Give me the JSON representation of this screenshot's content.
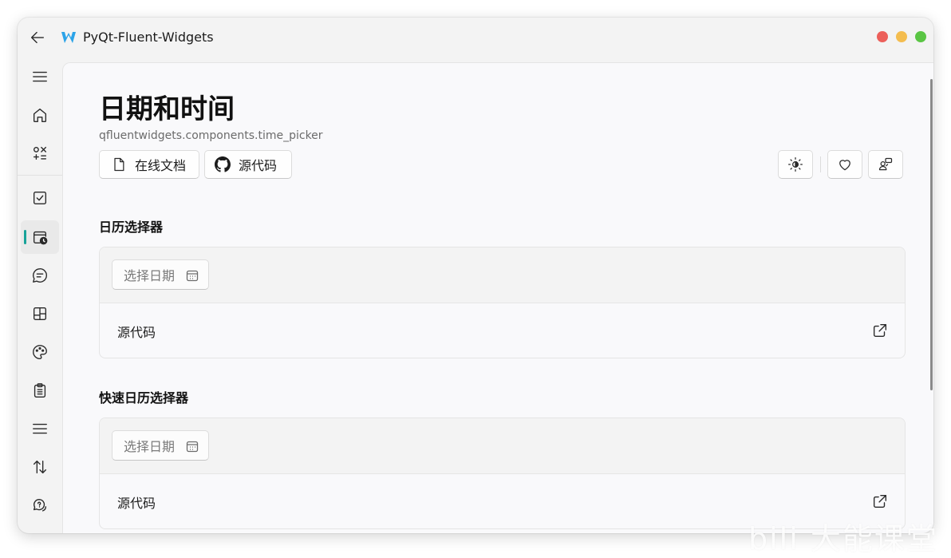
{
  "window": {
    "title": "PyQt-Fluent-Widgets",
    "traffic_lights": [
      "#ec5f5a",
      "#f4bd4f",
      "#5ac544"
    ]
  },
  "sidebar": {
    "accent_color": "#17a399",
    "items": [
      {
        "icon": "menu-icon",
        "active": false
      },
      {
        "icon": "home-icon",
        "active": false
      },
      {
        "icon": "gallery-icon",
        "active": false
      },
      {
        "icon": "checkbox-icon",
        "active": false
      },
      {
        "icon": "calendar-clock-icon",
        "active": true
      },
      {
        "icon": "chat-icon",
        "active": false
      },
      {
        "icon": "layout-icon",
        "active": false
      },
      {
        "icon": "palette-icon",
        "active": false
      },
      {
        "icon": "clipboard-icon",
        "active": false
      },
      {
        "icon": "list-icon",
        "active": false
      },
      {
        "icon": "sort-arrows-icon",
        "active": false
      },
      {
        "icon": "chat-help-icon",
        "active": false
      }
    ]
  },
  "header": {
    "title": "日期和时间",
    "module_path": "qfluentwidgets.components.time_picker",
    "docs_button": "在线文档",
    "source_button": "源代码",
    "icon_buttons": [
      "brightness-icon",
      "heart-icon",
      "feedback-icon"
    ]
  },
  "sections": [
    {
      "title": "日历选择器",
      "picker_placeholder": "选择日期",
      "footer_label": "源代码"
    },
    {
      "title": "快速日历选择器",
      "picker_placeholder": "选择日期",
      "footer_label": "源代码"
    }
  ],
  "watermark": "bili 大能课堂"
}
